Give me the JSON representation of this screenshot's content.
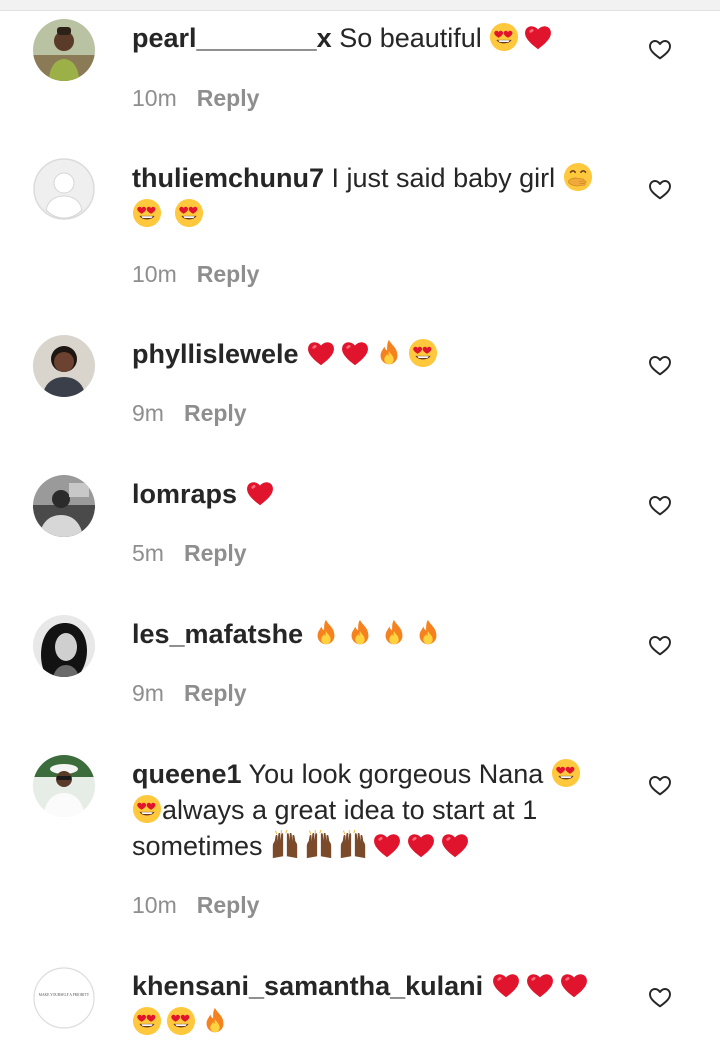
{
  "comments": [
    {
      "username": "pearl________x",
      "text": " So beautiful ",
      "emojis": [
        "heart-eyes",
        "red-heart"
      ],
      "time": "10m",
      "reply": "Reply"
    },
    {
      "username": "thuliemchunu7",
      "text": " I just said baby girl ",
      "emojis": [
        "hand-over-mouth",
        "heart-eyes",
        "heart-eyes"
      ],
      "time": "10m",
      "reply": "Reply"
    },
    {
      "username": "phyllislewele",
      "text": " ",
      "emojis": [
        "red-heart",
        "red-heart",
        "fire",
        "heart-eyes"
      ],
      "time": "9m",
      "reply": "Reply"
    },
    {
      "username": "lomraps",
      "text": " ",
      "emojis": [
        "red-heart"
      ],
      "time": "5m",
      "reply": "Reply"
    },
    {
      "username": "les_mafatshe",
      "text": " ",
      "emojis": [
        "fire",
        "fire",
        "fire",
        "fire"
      ],
      "time": "9m",
      "reply": "Reply"
    },
    {
      "username": "queene1",
      "text": " You look gorgeous Nana ",
      "text2": "always a great idea to start at 1 sometimes ",
      "emojis": [
        "heart-eyes",
        "heart-eyes",
        "raised-hands",
        "raised-hands",
        "raised-hands",
        "red-heart",
        "red-heart",
        "red-heart"
      ],
      "time": "10m",
      "reply": "Reply"
    },
    {
      "username": "khensani_samantha_kulani",
      "text": " ",
      "emojis": [
        "red-heart",
        "red-heart",
        "red-heart",
        "heart-eyes",
        "heart-eyes",
        "fire"
      ],
      "avatar_text": "MAKE YOURSELF A PRIORITY"
    }
  ],
  "colors": {
    "text": "#262626",
    "meta": "#8e8e8e",
    "heart": "#e0142c",
    "emoji_face": "#ffc83d"
  },
  "icons": {
    "like": "heart-outline-icon"
  }
}
